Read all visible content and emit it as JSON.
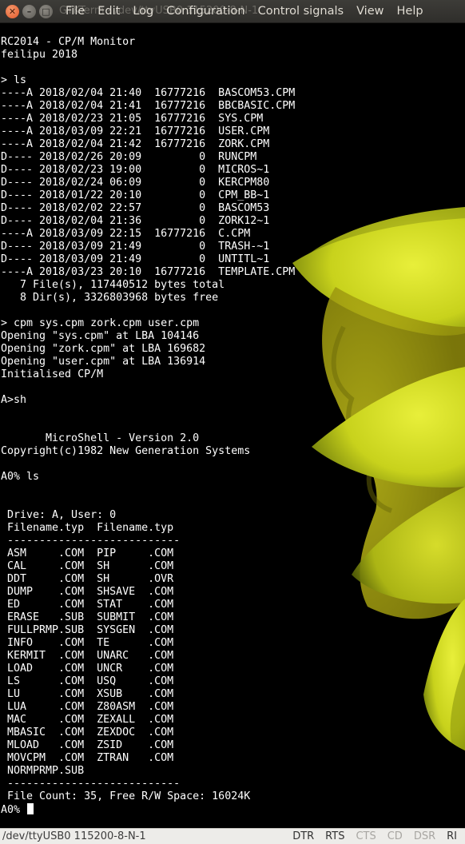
{
  "window": {
    "title": "GTKTerm - /dev/ttyUSB0  115200-8-N-1",
    "menu": [
      "File",
      "Edit",
      "Log",
      "Configuration",
      "Control signals",
      "View",
      "Help"
    ]
  },
  "terminal": {
    "lines": [
      "RC2014 - CP/M Monitor",
      "feilipu 2018",
      "",
      "> ls",
      "----A 2018/02/04 21:40  16777216  BASCOM53.CPM",
      "----A 2018/02/04 21:41  16777216  BBCBASIC.CPM",
      "----A 2018/02/23 21:05  16777216  SYS.CPM",
      "----A 2018/03/09 22:21  16777216  USER.CPM",
      "----A 2018/02/04 21:42  16777216  ZORK.CPM",
      "D---- 2018/02/26 20:09         0  RUNCPM",
      "D---- 2018/02/23 19:00         0  MICROS~1",
      "D---- 2018/02/24 06:09         0  KERCPM80",
      "D---- 2018/01/22 20:10         0  CPM_BB~1",
      "D---- 2018/02/02 22:57         0  BASCOM53",
      "D---- 2018/02/04 21:36         0  ZORK12~1",
      "----A 2018/03/09 22:15  16777216  C.CPM",
      "D---- 2018/03/09 21:49         0  TRASH-~1",
      "D---- 2018/03/09 21:49         0  UNTITL~1",
      "----A 2018/03/23 20:10  16777216  TEMPLATE.CPM",
      "   7 File(s), 117440512 bytes total",
      "   8 Dir(s), 3326803968 bytes free",
      "",
      "> cpm sys.cpm zork.cpm user.cpm",
      "Opening \"sys.cpm\" at LBA 104146",
      "Opening \"zork.cpm\" at LBA 169682",
      "Opening \"user.cpm\" at LBA 136914",
      "Initialised CP/M",
      "",
      "A>sh",
      "",
      "",
      "       MicroShell - Version 2.0",
      "Copyright(c)1982 New Generation Systems",
      "",
      "A0% ls",
      "",
      "",
      " Drive: A, User: 0",
      " Filename.typ  Filename.typ",
      " ---------------------------",
      " ASM     .COM  PIP     .COM",
      " CAL     .COM  SH      .COM",
      " DDT     .COM  SH      .OVR",
      " DUMP    .COM  SHSAVE  .COM",
      " ED      .COM  STAT    .COM",
      " ERASE   .SUB  SUBMIT  .COM",
      " FULLPRMP.SUB  SYSGEN  .COM",
      " INFO    .COM  TE      .COM",
      " KERMIT  .COM  UNARC   .COM",
      " LOAD    .COM  UNCR    .COM",
      " LS      .COM  USQ     .COM",
      " LU      .COM  XSUB    .COM",
      " LUA     .COM  Z80ASM  .COM",
      " MAC     .COM  ZEXALL  .COM",
      " MBASIC  .COM  ZEXDOC  .COM",
      " MLOAD   .COM  ZSID    .COM",
      " MOVCPM  .COM  ZTRAN   .COM",
      " NORMPRMP.SUB",
      " ---------------------------",
      " File Count: 35, Free R/W Space: 16024K"
    ],
    "prompt": "A0% "
  },
  "statusbar": {
    "port": "/dev/ttyUSB0  115200-8-N-1",
    "signals": [
      {
        "label": "DTR",
        "active": true
      },
      {
        "label": "RTS",
        "active": true
      },
      {
        "label": "CTS",
        "active": false
      },
      {
        "label": "CD",
        "active": false
      },
      {
        "label": "DSR",
        "active": false
      },
      {
        "label": "RI",
        "active": true
      }
    ]
  },
  "colors": {
    "terminal_bg": "#000000",
    "terminal_fg": "#ffffff",
    "titlebar_bg": "#3c3b37",
    "statusbar_bg": "#edece9",
    "flower_petal": "#d6e020"
  }
}
